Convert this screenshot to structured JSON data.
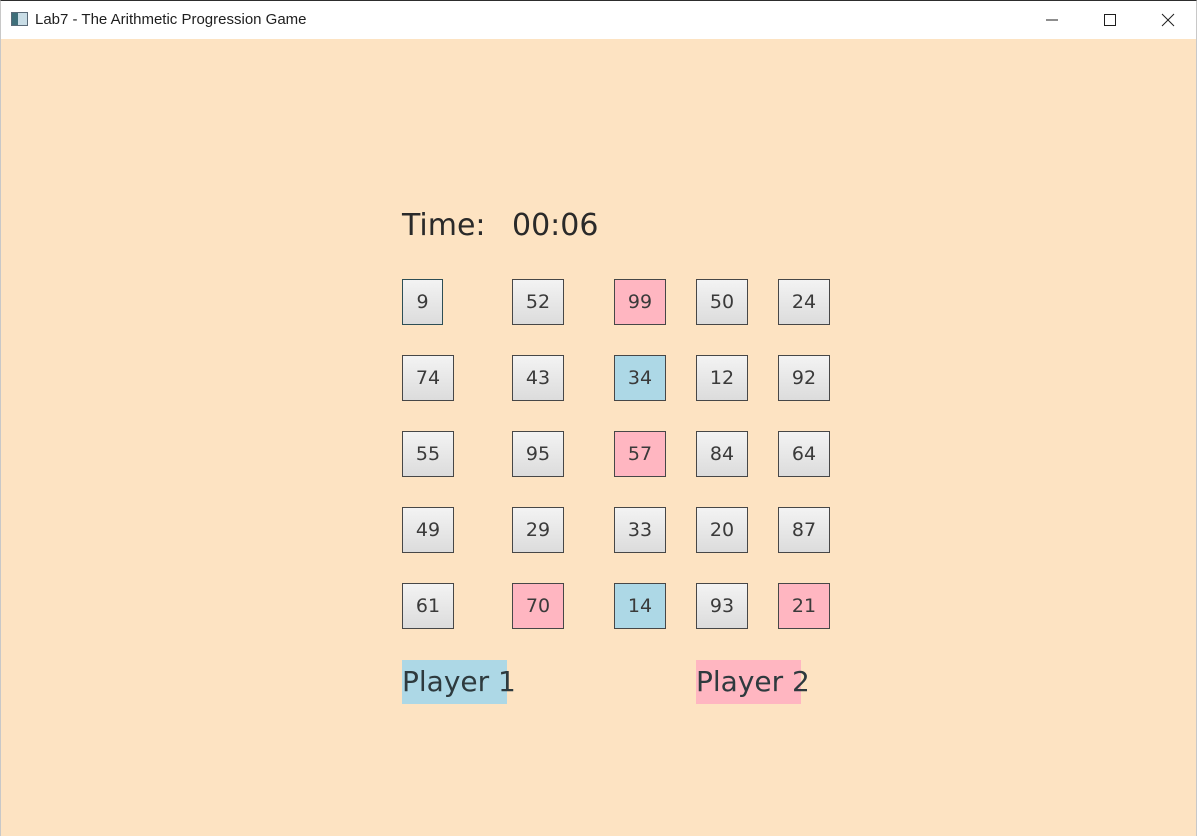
{
  "window": {
    "title": "Lab7 - The Arithmetic Progression Game",
    "icons": {
      "app": "window-app-icon",
      "minimize": "minimize-icon",
      "maximize": "maximize-icon",
      "close": "close-icon"
    }
  },
  "colors": {
    "background": "#fde3c2",
    "player1": "#add8e6",
    "player2": "#ffb6c1",
    "neutral_cell": "#e6e6e6"
  },
  "timer": {
    "label": "Time:",
    "value": "00:06"
  },
  "grid": [
    [
      {
        "value": "9",
        "owner": "none",
        "focused": true
      },
      {
        "value": "52",
        "owner": "none"
      },
      {
        "value": "99",
        "owner": "player2"
      },
      {
        "value": "50",
        "owner": "none"
      },
      {
        "value": "24",
        "owner": "none"
      }
    ],
    [
      {
        "value": "74",
        "owner": "none"
      },
      {
        "value": "43",
        "owner": "none"
      },
      {
        "value": "34",
        "owner": "player1"
      },
      {
        "value": "12",
        "owner": "none"
      },
      {
        "value": "92",
        "owner": "none"
      }
    ],
    [
      {
        "value": "55",
        "owner": "none"
      },
      {
        "value": "95",
        "owner": "none"
      },
      {
        "value": "57",
        "owner": "player2"
      },
      {
        "value": "84",
        "owner": "none"
      },
      {
        "value": "64",
        "owner": "none"
      }
    ],
    [
      {
        "value": "49",
        "owner": "none"
      },
      {
        "value": "29",
        "owner": "none"
      },
      {
        "value": "33",
        "owner": "none"
      },
      {
        "value": "20",
        "owner": "none"
      },
      {
        "value": "87",
        "owner": "none"
      }
    ],
    [
      {
        "value": "61",
        "owner": "none"
      },
      {
        "value": "70",
        "owner": "player2"
      },
      {
        "value": "14",
        "owner": "player1"
      },
      {
        "value": "93",
        "owner": "none"
      },
      {
        "value": "21",
        "owner": "player2"
      }
    ]
  ],
  "players": {
    "player1": "Player 1",
    "player2": "Player 2"
  }
}
